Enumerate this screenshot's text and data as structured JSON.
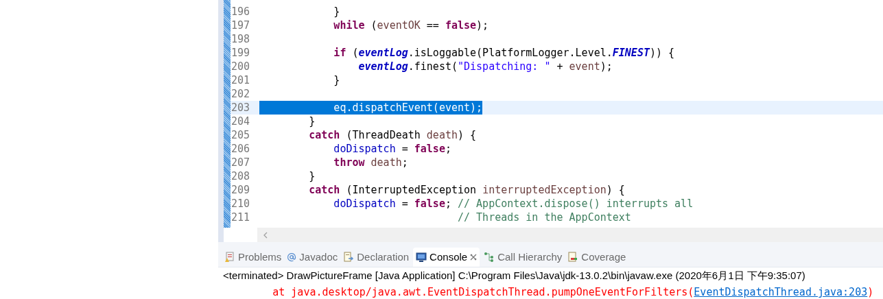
{
  "editor": {
    "lines": [
      {
        "number": "196",
        "selected": false,
        "segments": [
          {
            "kind": "plain",
            "text": "            }"
          }
        ]
      },
      {
        "number": "197",
        "selected": false,
        "segments": [
          {
            "kind": "keyword",
            "text": "            while"
          },
          {
            "kind": "plain",
            "text": " ("
          },
          {
            "kind": "local",
            "text": "eventOK"
          },
          {
            "kind": "plain",
            "text": " == "
          },
          {
            "kind": "keyword",
            "text": "false"
          },
          {
            "kind": "plain",
            "text": ");"
          }
        ]
      },
      {
        "number": "198",
        "selected": false
      },
      {
        "number": "199",
        "selected": false,
        "segments": [
          {
            "kind": "keyword",
            "text": "            if"
          },
          {
            "kind": "plain",
            "text": " ("
          },
          {
            "kind": "static",
            "text": "eventLog"
          },
          {
            "kind": "plain",
            "text": ".isLoggable(PlatformLogger.Level."
          },
          {
            "kind": "static",
            "text": "FINEST"
          },
          {
            "kind": "plain",
            "text": ")) {"
          }
        ]
      },
      {
        "number": "200",
        "selected": false,
        "segments": [
          {
            "kind": "static",
            "text": "                eventLog"
          },
          {
            "kind": "plain",
            "text": ".finest("
          },
          {
            "kind": "string",
            "text": "\"Dispatching: \""
          },
          {
            "kind": "plain",
            "text": " + "
          },
          {
            "kind": "local",
            "text": "event"
          },
          {
            "kind": "plain",
            "text": ");"
          }
        ]
      },
      {
        "number": "201",
        "selected": false,
        "segments": [
          {
            "kind": "plain",
            "text": "            }"
          }
        ]
      },
      {
        "number": "202",
        "selected": false
      },
      {
        "number": "203",
        "selected": true,
        "segments": [
          {
            "kind": "plain",
            "text": "            eq.dispatchEvent(event);"
          }
        ]
      },
      {
        "number": "204",
        "selected": false,
        "segments": [
          {
            "kind": "plain",
            "text": "        }"
          }
        ]
      },
      {
        "number": "205",
        "selected": false,
        "segments": [
          {
            "kind": "keyword",
            "text": "        catch"
          },
          {
            "kind": "plain",
            "text": " (ThreadDeath "
          },
          {
            "kind": "local",
            "text": "death"
          },
          {
            "kind": "plain",
            "text": ") {"
          }
        ]
      },
      {
        "number": "206",
        "selected": false,
        "segments": [
          {
            "kind": "field",
            "text": "            doDispatch"
          },
          {
            "kind": "plain",
            "text": " = "
          },
          {
            "kind": "keyword",
            "text": "false"
          },
          {
            "kind": "plain",
            "text": ";"
          }
        ]
      },
      {
        "number": "207",
        "selected": false,
        "segments": [
          {
            "kind": "keyword",
            "text": "            throw"
          },
          {
            "kind": "local",
            "text": " death"
          },
          {
            "kind": "plain",
            "text": ";"
          }
        ]
      },
      {
        "number": "208",
        "selected": false,
        "segments": [
          {
            "kind": "plain",
            "text": "        }"
          }
        ]
      },
      {
        "number": "209",
        "selected": false,
        "segments": [
          {
            "kind": "keyword",
            "text": "        catch"
          },
          {
            "kind": "plain",
            "text": " (InterruptedException "
          },
          {
            "kind": "local",
            "text": "interruptedException"
          },
          {
            "kind": "plain",
            "text": ") {"
          }
        ]
      },
      {
        "number": "210",
        "selected": false,
        "segments": [
          {
            "kind": "field",
            "text": "            doDispatch"
          },
          {
            "kind": "plain",
            "text": " = "
          },
          {
            "kind": "keyword",
            "text": "false"
          },
          {
            "kind": "plain",
            "text": "; "
          },
          {
            "kind": "comment",
            "text": "// AppContext.dispose() interrupts all"
          }
        ]
      },
      {
        "number": "211",
        "selected": false,
        "segments": [
          {
            "kind": "comment",
            "text": "                                // Threads in the AppContext"
          }
        ]
      }
    ]
  },
  "views": {
    "tabs": [
      {
        "label": "Problems",
        "kind": "problems",
        "selected": false
      },
      {
        "label": "Javadoc",
        "kind": "javadoc",
        "selected": false
      },
      {
        "label": "Declaration",
        "kind": "declaration",
        "selected": false
      },
      {
        "label": "Console",
        "kind": "console",
        "selected": true
      },
      {
        "label": "Call Hierarchy",
        "kind": "hierarchy",
        "selected": false
      },
      {
        "label": "Coverage",
        "kind": "coverage",
        "selected": false
      }
    ]
  },
  "console": {
    "header": "<terminated> DrawPictureFrame [Java Application] C:\\Program Files\\Java\\jdk-13.0.2\\bin\\javaw.exe (2020年6月1日 下午9:35:07)",
    "error_line": {
      "text": "\tat java.desktop/java.awt.EventDispatchThread.pumpOneEventForFilters(",
      "link": "EventDispatchThread.java:203",
      "tail": ")"
    }
  }
}
